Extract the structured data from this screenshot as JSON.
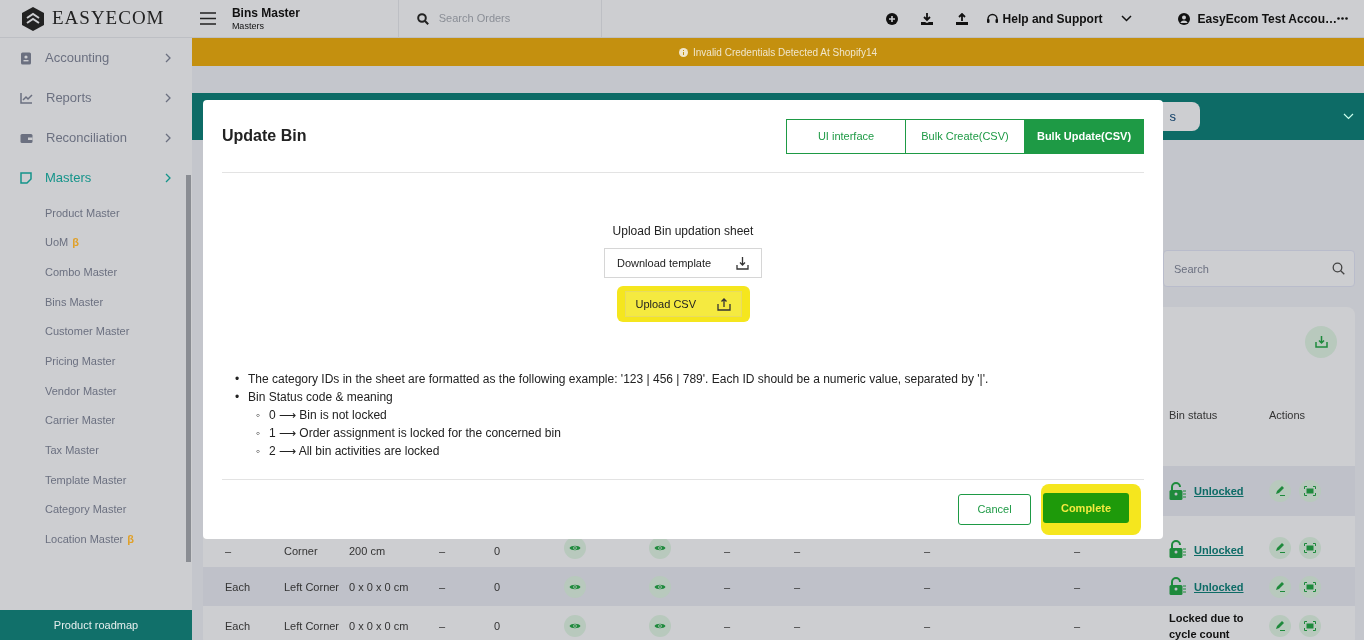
{
  "topbar": {
    "logo_text": "EASYECOM",
    "page_title": "Bins Master",
    "breadcrumb": "Masters",
    "search": {
      "placeholder": "Search Orders"
    },
    "help_label": "Help and Support",
    "account_name": "EasyEcom Test Accou…"
  },
  "sidebar": {
    "items": [
      {
        "label": "Accounting",
        "selected": false
      },
      {
        "label": "Reports",
        "selected": false
      },
      {
        "label": "Reconciliation",
        "selected": false
      },
      {
        "label": "Masters",
        "selected": true,
        "children": [
          {
            "label": "Product Master"
          },
          {
            "label": "UoM",
            "badge": "β"
          },
          {
            "label": "Combo Master"
          },
          {
            "label": "Bins Master"
          },
          {
            "label": "Customer Master"
          },
          {
            "label": "Pricing Master"
          },
          {
            "label": "Vendor Master"
          },
          {
            "label": "Carrier Master"
          },
          {
            "label": "Tax Master"
          },
          {
            "label": "Template Master"
          },
          {
            "label": "Category Master"
          },
          {
            "label": "Location Master",
            "badge": "β"
          }
        ]
      }
    ],
    "footer_button": "Product roadmap"
  },
  "banner": {
    "text": "Invalid Credentials Detected At Shopify14"
  },
  "toolbar": {
    "pill_text": "s"
  },
  "search": {
    "placeholder": "Search"
  },
  "table": {
    "columns": [
      "Bin status",
      "Actions"
    ],
    "rows": [
      {
        "cells": {},
        "bin_status": {
          "kind": "unlocked",
          "label": "Unlocked"
        }
      },
      {
        "cells": {
          "column_1": "–",
          "column_2": "Corner",
          "column_3": "200 cm",
          "column_4": "–",
          "column_5": "0",
          "column_8": "–",
          "column_9": "–",
          "column_10": "–",
          "column_11": "–"
        },
        "bin_status": {
          "kind": "unlocked",
          "label": "Unlocked"
        }
      },
      {
        "cells": {
          "column_1": "Each",
          "column_2": "Left Corner",
          "column_3": "0 x 0 x 0 cm",
          "column_4": "–",
          "column_5": "0",
          "column_8": "–",
          "column_9": "–",
          "column_10": "–",
          "column_11": "–"
        },
        "bin_status": {
          "kind": "unlocked",
          "label": "Unlocked"
        }
      },
      {
        "cells": {
          "column_1": "Each",
          "column_2": "Left Corner",
          "column_3": "0 x 0 x 0 cm",
          "column_4": "–",
          "column_5": "0",
          "column_8": "–",
          "column_9": "–",
          "column_10": "–",
          "column_11": "–"
        },
        "bin_status": {
          "kind": "locked",
          "label": "Locked due to cycle count"
        }
      }
    ]
  },
  "modal": {
    "title": "Update Bin",
    "tabs": [
      {
        "label": "UI interface",
        "selected": false
      },
      {
        "label": "Bulk Create(CSV)",
        "selected": false
      },
      {
        "label": "Bulk Update(CSV)",
        "selected": true
      }
    ],
    "upload_label": "Upload Bin updation sheet",
    "download_button": "Download template",
    "upload_button": {
      "label": "Upload CSV",
      "highlighted": true
    },
    "notes": [
      {
        "marker": "•",
        "text": "The category IDs in the sheet are formatted as the following example: '123 | 456 | 789'. Each ID should be a numeric value, separated by '|'."
      },
      {
        "marker": "•",
        "text": "Bin Status code & meaning",
        "children": [
          {
            "marker": "◦",
            "text": "0 ⟶ Bin is not locked"
          },
          {
            "marker": "◦",
            "text": "1 ⟶ Order assignment is locked for the concerned bin"
          },
          {
            "marker": "◦",
            "text": "2 ⟶ All bin activities are locked"
          }
        ]
      }
    ],
    "buttons": [
      {
        "label": "Cancel",
        "kind": "secondary",
        "highlighted": false
      },
      {
        "label": "Complete",
        "kind": "primary",
        "highlighted": true
      }
    ]
  }
}
